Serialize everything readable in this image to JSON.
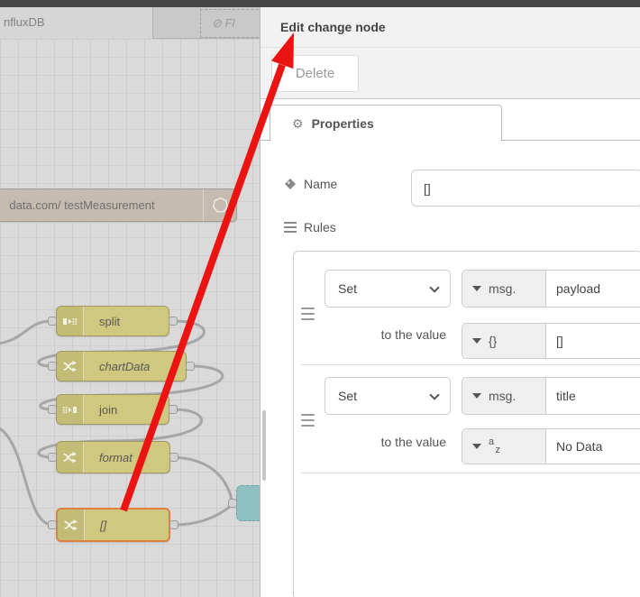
{
  "workspace": {
    "tab_active": "nfluxDB",
    "tab_ghost": "⊘ Fl",
    "influx_node": {
      "label": "data.com/ testMeasurement"
    },
    "nodes": [
      {
        "label": "split"
      },
      {
        "label": "chartData"
      },
      {
        "label": "join"
      },
      {
        "label": "format"
      },
      {
        "label": "[]"
      }
    ],
    "colors": {
      "node_yellow": "#cfc87e",
      "selected_orange": "#dd8040",
      "teal_node": "#8cc0c1",
      "wire": "#a6a6a6",
      "influx_tan": "#c6bbb1"
    }
  },
  "arrow": {
    "color": "#ec1313"
  },
  "tray": {
    "title": "Edit change node",
    "delete_button": "Delete",
    "properties_tab": "Properties",
    "icons": {
      "gear": "⚙"
    },
    "name_label": "Name",
    "name_value": "[]",
    "rules_label": "Rules",
    "rules": [
      {
        "op": "Set",
        "prop_type": "msg.",
        "prop": "payload",
        "to_label": "to the value",
        "value_type": "{}",
        "value": "[]"
      },
      {
        "op": "Set",
        "prop_type": "msg.",
        "prop": "title",
        "to_label": "to the value",
        "value_type_a": "a",
        "value_type_z": "z",
        "value": "No Data"
      }
    ]
  }
}
